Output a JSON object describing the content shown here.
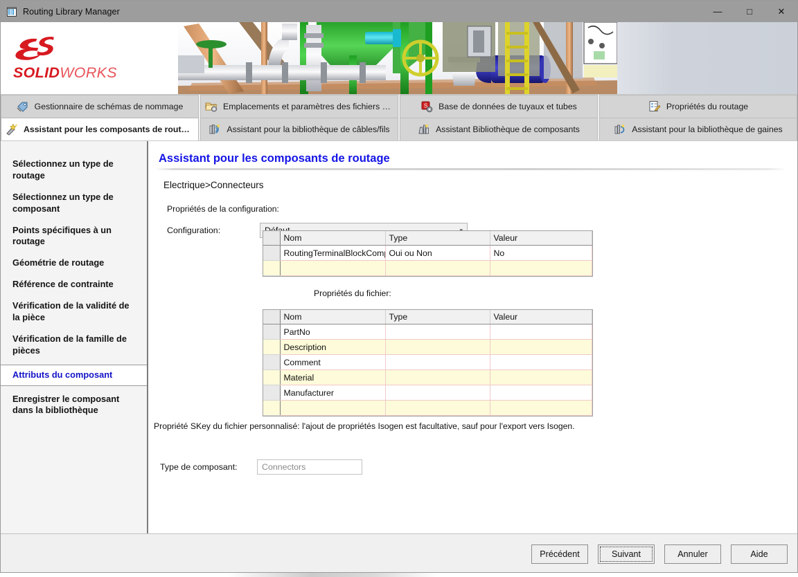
{
  "window": {
    "title": "Routing Library Manager",
    "icon": "routing-library-icon",
    "controls": {
      "minimize": "—",
      "maximize": "□",
      "close": "✕"
    }
  },
  "banner": {
    "logo_mark": "ds-logo",
    "brand_bold": "SOLID",
    "brand_light": "WORKS",
    "artwork": "piping-assembly-render"
  },
  "tabs": {
    "row1": [
      {
        "label": "Gestionnaire de schémas de nommage",
        "icon": "naming-scheme-icon",
        "active": false
      },
      {
        "label": "Emplacements et paramètres des fichiers de routage",
        "icon": "file-locations-icon",
        "active": false
      },
      {
        "label": "Base de données de tuyaux et tubes",
        "icon": "pipe-database-icon",
        "active": false
      },
      {
        "label": "Propriétés du routage",
        "icon": "routing-properties-icon",
        "active": false
      }
    ],
    "row2": [
      {
        "label": "Assistant pour les composants de routage",
        "icon": "component-wizard-icon",
        "active": true
      },
      {
        "label": "Assistant pour la bibliothèque de câbles/fils",
        "icon": "cable-library-icon",
        "active": false
      },
      {
        "label": "Assistant Bibliothèque de composants",
        "icon": "component-library-icon",
        "active": false
      },
      {
        "label": "Assistant pour la bibliothèque de gaines",
        "icon": "conduit-library-icon",
        "active": false
      }
    ]
  },
  "sidebar": {
    "items": [
      {
        "label": "Sélectionnez un type de routage",
        "active": false
      },
      {
        "label": "Sélectionnez un type de composant",
        "active": false
      },
      {
        "label": "Points spécifiques à un routage",
        "active": false
      },
      {
        "label": "Géométrie de routage",
        "active": false
      },
      {
        "label": "Référence de contrainte",
        "active": false
      },
      {
        "label": "Vérification de la validité de la pièce",
        "active": false
      },
      {
        "label": "Vérification de la famille de pièces",
        "active": false
      },
      {
        "label": "Attributs du composant",
        "active": true
      },
      {
        "label": "Enregistrer le composant dans la bibliothèque",
        "active": false
      }
    ]
  },
  "content": {
    "page_title": "Assistant pour les composants de routage",
    "breadcrumb": "Electrique>Connecteurs",
    "config_section_label": "Propriétés de la configuration:",
    "configuration_label": "Configuration:",
    "configuration_value": "Défaut",
    "file_section_label": "Propriétés du fichier:",
    "skey_note": "Propriété SKey du fichier personnalisé:  l'ajout de propriétés Isogen est facultative, sauf pour l'export vers Isogen.",
    "component_type_label": "Type de composant:",
    "component_type_value": "Connectors"
  },
  "config_table": {
    "columns": [
      "Nom",
      "Type",
      "Valeur"
    ],
    "rows": [
      {
        "cells": [
          "RoutingTerminalBlockComp",
          "Oui ou Non",
          "No"
        ],
        "alt": false
      },
      {
        "cells": [
          "",
          "",
          ""
        ],
        "alt": true
      }
    ]
  },
  "file_table": {
    "columns": [
      "Nom",
      "Type",
      "Valeur"
    ],
    "rows": [
      {
        "cells": [
          "PartNo",
          "",
          ""
        ],
        "alt": false
      },
      {
        "cells": [
          "Description",
          "",
          ""
        ],
        "alt": true
      },
      {
        "cells": [
          "Comment",
          "",
          ""
        ],
        "alt": false
      },
      {
        "cells": [
          "Material",
          "",
          ""
        ],
        "alt": true
      },
      {
        "cells": [
          "Manufacturer",
          "",
          ""
        ],
        "alt": false
      },
      {
        "cells": [
          "",
          "",
          ""
        ],
        "alt": true
      }
    ]
  },
  "footer": {
    "buttons": [
      {
        "label": "Précédent",
        "focused": false
      },
      {
        "label": "Suivant",
        "focused": true
      },
      {
        "label": "Annuler",
        "focused": false
      },
      {
        "label": "Aide",
        "focused": false
      }
    ]
  },
  "colors": {
    "accent_blue": "#1414e6",
    "brand_red": "#d71920",
    "alt_row": "#fdfbd9",
    "titlebar": "#9d9d9d"
  }
}
